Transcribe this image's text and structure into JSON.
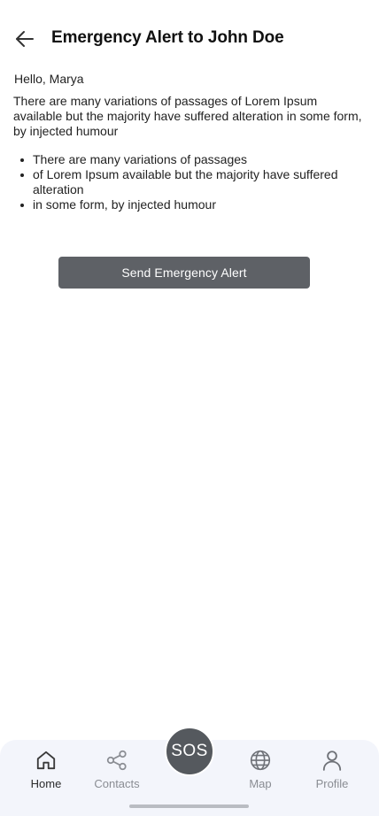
{
  "header": {
    "title": "Emergency Alert to John Doe",
    "back_icon": "arrow-left-icon"
  },
  "content": {
    "greeting": "Hello, Marya",
    "paragraph": "There are many variations of passages of Lorem Ipsum available but the majority have suffered alteration in some form, by injected humour",
    "bullets": [
      "There are many variations of passages",
      "of Lorem Ipsum available but the majority have suffered alteration",
      "in some form, by injected humour"
    ]
  },
  "actions": {
    "send_label": "Send Emergency Alert",
    "button_color": "#5e6166"
  },
  "tabbar": {
    "items": [
      {
        "label": "Home",
        "icon": "home-icon",
        "active": true
      },
      {
        "label": "Contacts",
        "icon": "share-icon",
        "active": false
      },
      {
        "label": "Map",
        "icon": "globe-icon",
        "active": false
      },
      {
        "label": "Profile",
        "icon": "person-icon",
        "active": false
      }
    ],
    "sos_label": "SOS",
    "sos_color": "#55595e"
  }
}
